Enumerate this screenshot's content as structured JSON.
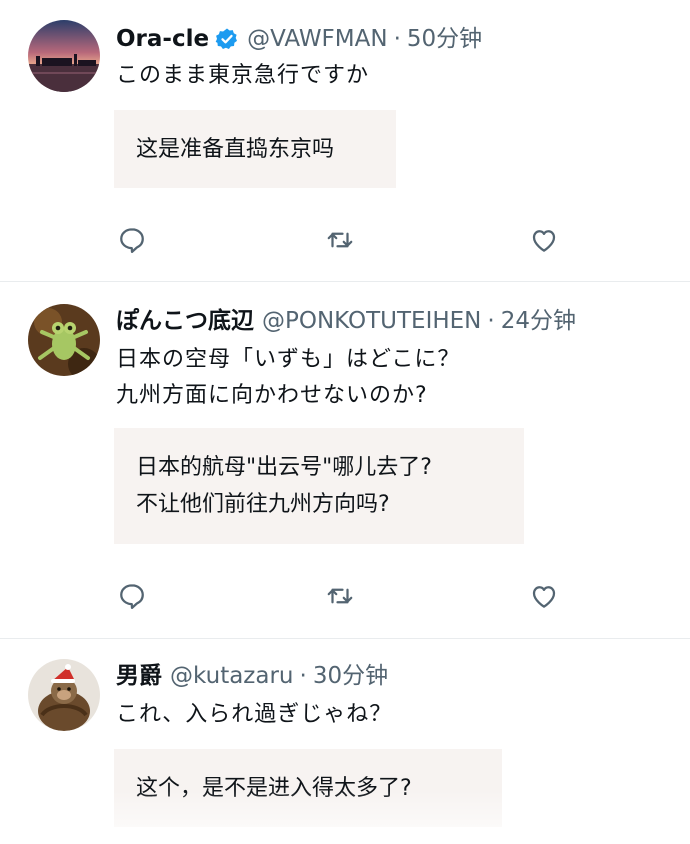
{
  "tweets": [
    {
      "name": "Ora-cle",
      "verified": true,
      "handle": "@VAWFMAN",
      "separator": "·",
      "time": "50分钟",
      "text_lines": [
        "このまま東京急行ですか"
      ],
      "translation_lines": [
        "这是准备直捣东京吗"
      ],
      "avatar_icon": "sunset-harbor-avatar"
    },
    {
      "name": "ぽんこつ底辺",
      "verified": false,
      "handle": "@PONKOTUTEIHEN",
      "separator": "·",
      "time": "24分钟",
      "text_lines": [
        "日本の空母「いずも」はどこに？",
        "九州方面に向かわせないのか?"
      ],
      "translation_lines": [
        "日本的航母\"出云号\"哪儿去了?",
        "不让他们前往九州方向吗?"
      ],
      "avatar_icon": "frog-avatar"
    },
    {
      "name": "男爵",
      "verified": false,
      "handle": "@kutazaru",
      "separator": "·",
      "time": "30分钟",
      "text_lines": [
        "これ、入られ過ぎじゃね？"
      ],
      "translation_lines": [
        "这个，是不是进入得太多了?"
      ],
      "avatar_icon": "monkey-santa-hat-avatar"
    }
  ],
  "actions": [
    "reply-icon",
    "retweet-icon",
    "like-icon"
  ],
  "colors": {
    "text": "#0f1419",
    "secondary": "#536471",
    "verified": "#1d9bf0",
    "translation_bg": "#f7f3f1",
    "divider": "#e9ecee"
  }
}
